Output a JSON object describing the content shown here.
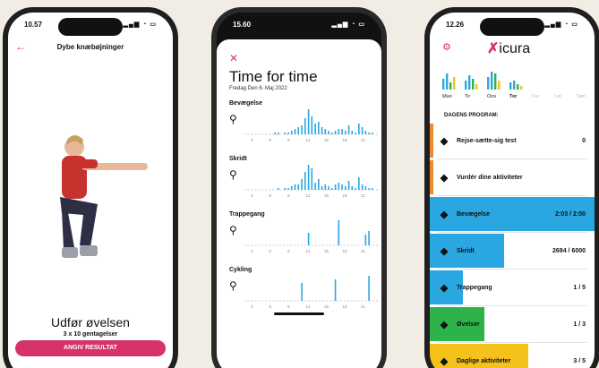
{
  "colors": {
    "accent": "#d6336b",
    "blue": "#2aa7e0",
    "green": "#2db34a",
    "yellow": "#f4c21b",
    "orange": "#f08a32"
  },
  "phone1": {
    "time": "10.57",
    "header": "Dybe knæbøjninger",
    "title": "Udfør øvelsen",
    "subtitle": "3 x 10 gentagelser",
    "button": "ANGIV RESULTAT"
  },
  "phone2": {
    "time": "15.60",
    "title": "Time for time",
    "date": "Fredag Den 6. Maj 2022",
    "activities": [
      {
        "label": "Bevægelse",
        "icon": "walking-icon",
        "values": [
          0,
          0,
          0,
          0,
          0,
          0,
          0,
          0,
          0,
          1,
          1,
          0,
          1,
          1,
          2,
          3,
          4,
          5,
          9,
          14,
          10,
          6,
          7,
          4,
          3,
          2,
          1,
          2,
          3,
          3,
          2,
          5,
          2,
          1,
          6,
          4,
          2,
          1,
          1,
          0
        ]
      },
      {
        "label": "Skridt",
        "icon": "steps-icon",
        "values": [
          0,
          0,
          0,
          0,
          0,
          0,
          0,
          0,
          0,
          0,
          1,
          0,
          1,
          1,
          2,
          3,
          3,
          6,
          10,
          14,
          12,
          4,
          6,
          2,
          3,
          2,
          1,
          3,
          4,
          3,
          2,
          5,
          2,
          1,
          7,
          3,
          2,
          1,
          1,
          0
        ]
      },
      {
        "label": "Trappegang",
        "icon": "stairs-icon",
        "values": [
          0,
          0,
          0,
          0,
          0,
          0,
          0,
          0,
          0,
          0,
          0,
          0,
          0,
          0,
          0,
          0,
          0,
          0,
          0,
          7,
          0,
          0,
          0,
          0,
          0,
          0,
          0,
          0,
          14,
          0,
          0,
          0,
          0,
          0,
          0,
          0,
          6,
          8,
          0,
          0
        ]
      },
      {
        "label": "Cykling",
        "icon": "bike-icon",
        "values": [
          0,
          0,
          0,
          0,
          0,
          0,
          0,
          0,
          0,
          0,
          0,
          0,
          0,
          0,
          0,
          0,
          0,
          10,
          0,
          0,
          0,
          0,
          0,
          0,
          0,
          0,
          0,
          12,
          0,
          0,
          0,
          0,
          0,
          0,
          0,
          0,
          0,
          14,
          0,
          0
        ]
      }
    ],
    "ticks": [
      "3",
      "6",
      "9",
      "12",
      "15",
      "18",
      "21"
    ]
  },
  "phone3": {
    "time": "12.26",
    "logo": "icura",
    "days": [
      {
        "label": "Man",
        "bars": [
          12,
          18,
          8,
          14
        ]
      },
      {
        "label": "Tir",
        "bars": [
          10,
          16,
          12,
          6
        ]
      },
      {
        "label": "Ons",
        "bars": [
          14,
          20,
          18,
          10
        ]
      },
      {
        "label": "Tor",
        "bars": [
          8,
          10,
          6,
          4
        ]
      },
      {
        "label": "Fre",
        "bars": [
          0,
          0,
          0,
          0
        ]
      },
      {
        "label": "Lør",
        "bars": [
          0,
          0,
          0,
          0
        ]
      },
      {
        "label": "Søn",
        "bars": [
          0,
          0,
          0,
          0
        ]
      }
    ],
    "section": "DAGENS PROGRAM:",
    "items": [
      {
        "label": "Rejse-sætte-sig test",
        "value": "0",
        "icon": "sit-stand-icon",
        "color": "#f08a32",
        "fill": 0.0
      },
      {
        "label": "Vurdér dine aktiviteter",
        "value": "",
        "icon": "clipboard-icon",
        "color": "#f08a32",
        "fill": 0.0
      },
      {
        "label": "Bevægelse",
        "value": "2:03 / 2:00",
        "icon": "walking-icon",
        "color": "#2aa7e0",
        "fill": 1.0
      },
      {
        "label": "Skridt",
        "value": "2694 / 6000",
        "icon": "steps-icon",
        "color": "#2aa7e0",
        "fill": 0.45
      },
      {
        "label": "Trappegang",
        "value": "1 / 5",
        "icon": "stairs-icon",
        "color": "#2aa7e0",
        "fill": 0.2
      },
      {
        "label": "Øvelser",
        "value": "1 / 3",
        "icon": "exercise-icon",
        "color": "#2db34a",
        "fill": 0.33
      },
      {
        "label": "Daglige aktiviteter",
        "value": "3 / 5",
        "icon": "daily-activity-icon",
        "color": "#f4c21b",
        "fill": 0.6
      }
    ]
  }
}
